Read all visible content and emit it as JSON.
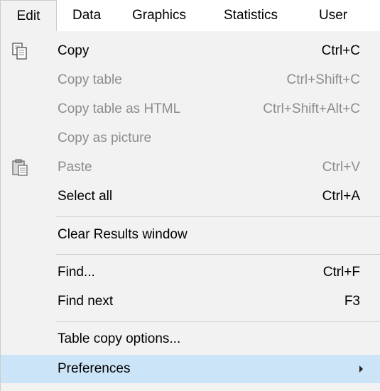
{
  "menubar": {
    "items": [
      {
        "label": "Edit",
        "active": true
      },
      {
        "label": "Data"
      },
      {
        "label": "Graphics"
      },
      {
        "label": "Statistics"
      },
      {
        "label": "User"
      }
    ]
  },
  "edit_menu": {
    "items": [
      {
        "label": "Copy",
        "shortcut": "Ctrl+C",
        "enabled": true,
        "icon": "copy-icon"
      },
      {
        "label": "Copy table",
        "shortcut": "Ctrl+Shift+C",
        "enabled": false
      },
      {
        "label": "Copy table as HTML",
        "shortcut": "Ctrl+Shift+Alt+C",
        "enabled": false
      },
      {
        "label": "Copy as picture",
        "shortcut": "",
        "enabled": false
      },
      {
        "label": "Paste",
        "shortcut": "Ctrl+V",
        "enabled": false,
        "icon": "paste-icon"
      },
      {
        "label": "Select all",
        "shortcut": "Ctrl+A",
        "enabled": true
      },
      {
        "label": "Clear Results window",
        "shortcut": "",
        "enabled": true
      },
      {
        "label": "Find...",
        "shortcut": "Ctrl+F",
        "enabled": true
      },
      {
        "label": "Find next",
        "shortcut": "F3",
        "enabled": true
      },
      {
        "label": "Table copy options...",
        "shortcut": "",
        "enabled": true
      },
      {
        "label": "Preferences",
        "shortcut": "",
        "enabled": true,
        "highlighted": true,
        "submenu": true
      }
    ]
  },
  "colors": {
    "menu_background": "#f2f2f2",
    "highlight": "#cce4f7",
    "disabled_text": "#8c8c8c",
    "separator": "#cdcdcd"
  }
}
